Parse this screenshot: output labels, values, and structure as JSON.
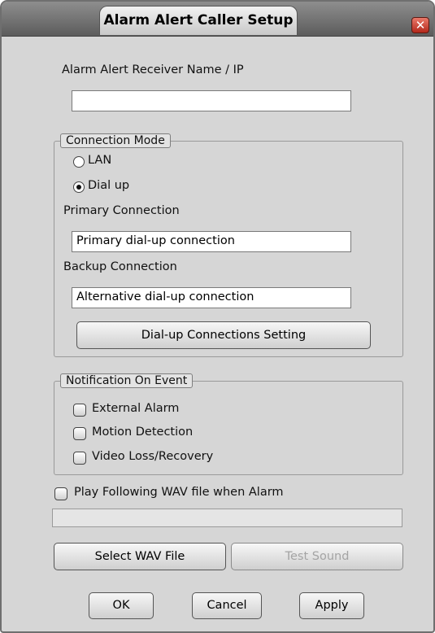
{
  "window": {
    "title": "Alarm Alert Caller Setup",
    "close_glyph": "✕"
  },
  "receiver": {
    "label": "Alarm Alert Receiver Name / IP",
    "value": ""
  },
  "connection_mode": {
    "legend": "Connection Mode",
    "options": [
      {
        "label": "LAN",
        "selected": false
      },
      {
        "label": "Dial up",
        "selected": true
      }
    ],
    "primary_label": "Primary Connection",
    "primary_value": "Primary dial-up connection",
    "backup_label": "Backup Connection",
    "backup_value": "Alternative dial-up connection",
    "settings_button": "Dial-up Connections Setting"
  },
  "notification": {
    "legend": "Notification On Event",
    "items": [
      {
        "label": "External Alarm",
        "checked": false
      },
      {
        "label": "Motion Detection",
        "checked": false
      },
      {
        "label": "Video Loss/Recovery",
        "checked": false
      }
    ]
  },
  "wav": {
    "play_label": "Play Following WAV file when Alarm",
    "play_checked": false,
    "file_path": "",
    "select_button": "Select WAV File",
    "test_button": "Test Sound"
  },
  "footer": {
    "ok": "OK",
    "cancel": "Cancel",
    "apply": "Apply"
  }
}
